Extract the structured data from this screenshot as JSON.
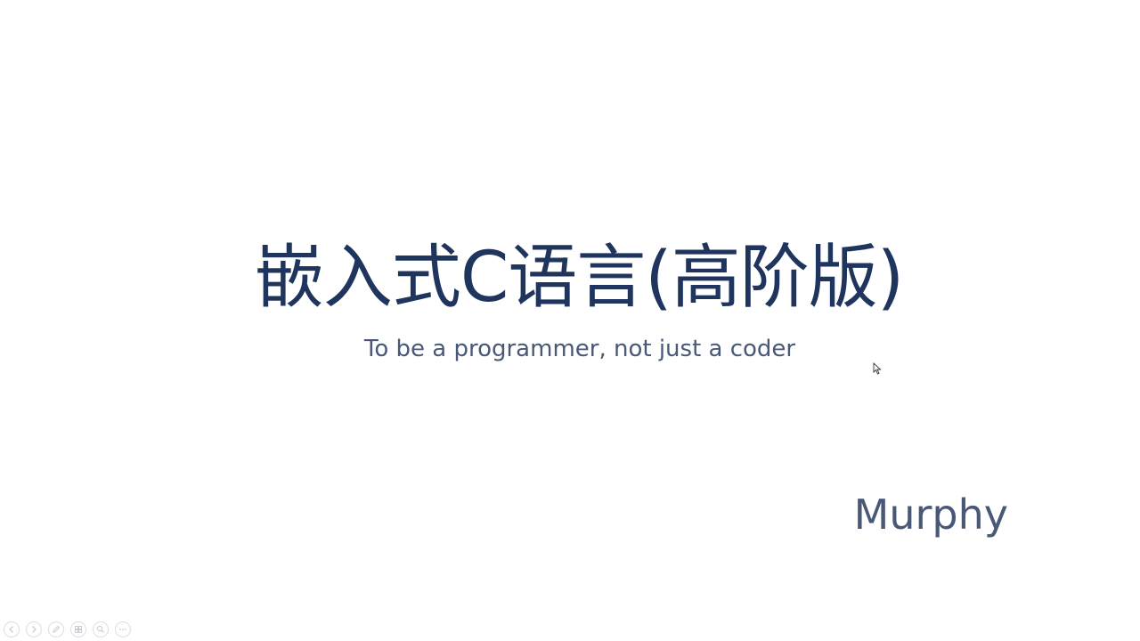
{
  "slide": {
    "title": "嵌入式C语言(高阶版)",
    "subtitle": "To be a programmer, not just a coder",
    "author": "Murphy"
  },
  "controls": {
    "icons": [
      "previous-icon",
      "next-icon",
      "pen-icon",
      "slides-grid-icon",
      "zoom-icon",
      "more-icon"
    ]
  },
  "colors": {
    "title": "#1f355e",
    "text": "#4a5878",
    "background": "#ffffff"
  }
}
